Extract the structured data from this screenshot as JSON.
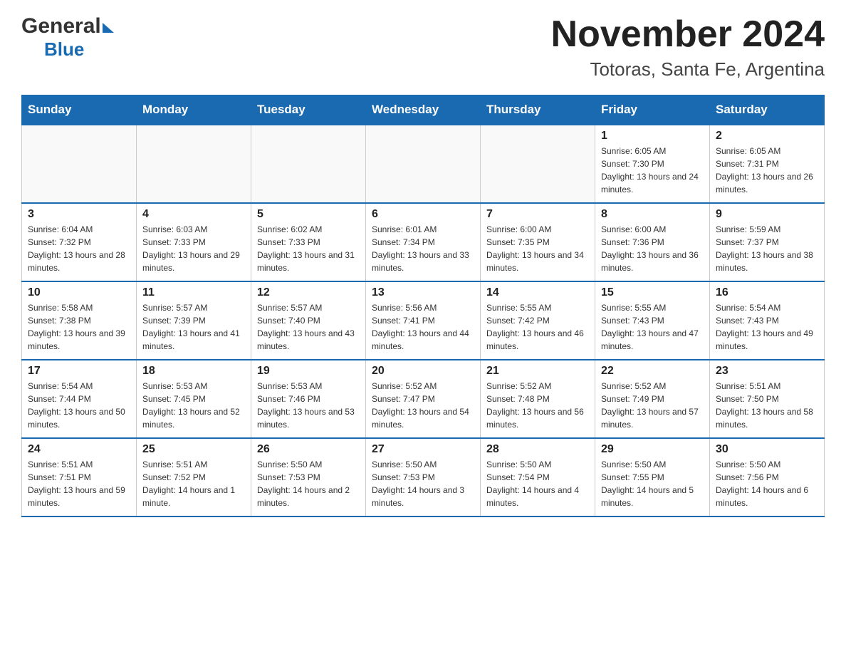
{
  "header": {
    "logo": {
      "general": "General",
      "blue": "Blue"
    },
    "title": "November 2024",
    "location": "Totoras, Santa Fe, Argentina"
  },
  "calendar": {
    "weekdays": [
      "Sunday",
      "Monday",
      "Tuesday",
      "Wednesday",
      "Thursday",
      "Friday",
      "Saturday"
    ],
    "weeks": [
      [
        {
          "day": "",
          "info": ""
        },
        {
          "day": "",
          "info": ""
        },
        {
          "day": "",
          "info": ""
        },
        {
          "day": "",
          "info": ""
        },
        {
          "day": "",
          "info": ""
        },
        {
          "day": "1",
          "info": "Sunrise: 6:05 AM\nSunset: 7:30 PM\nDaylight: 13 hours and 24 minutes."
        },
        {
          "day": "2",
          "info": "Sunrise: 6:05 AM\nSunset: 7:31 PM\nDaylight: 13 hours and 26 minutes."
        }
      ],
      [
        {
          "day": "3",
          "info": "Sunrise: 6:04 AM\nSunset: 7:32 PM\nDaylight: 13 hours and 28 minutes."
        },
        {
          "day": "4",
          "info": "Sunrise: 6:03 AM\nSunset: 7:33 PM\nDaylight: 13 hours and 29 minutes."
        },
        {
          "day": "5",
          "info": "Sunrise: 6:02 AM\nSunset: 7:33 PM\nDaylight: 13 hours and 31 minutes."
        },
        {
          "day": "6",
          "info": "Sunrise: 6:01 AM\nSunset: 7:34 PM\nDaylight: 13 hours and 33 minutes."
        },
        {
          "day": "7",
          "info": "Sunrise: 6:00 AM\nSunset: 7:35 PM\nDaylight: 13 hours and 34 minutes."
        },
        {
          "day": "8",
          "info": "Sunrise: 6:00 AM\nSunset: 7:36 PM\nDaylight: 13 hours and 36 minutes."
        },
        {
          "day": "9",
          "info": "Sunrise: 5:59 AM\nSunset: 7:37 PM\nDaylight: 13 hours and 38 minutes."
        }
      ],
      [
        {
          "day": "10",
          "info": "Sunrise: 5:58 AM\nSunset: 7:38 PM\nDaylight: 13 hours and 39 minutes."
        },
        {
          "day": "11",
          "info": "Sunrise: 5:57 AM\nSunset: 7:39 PM\nDaylight: 13 hours and 41 minutes."
        },
        {
          "day": "12",
          "info": "Sunrise: 5:57 AM\nSunset: 7:40 PM\nDaylight: 13 hours and 43 minutes."
        },
        {
          "day": "13",
          "info": "Sunrise: 5:56 AM\nSunset: 7:41 PM\nDaylight: 13 hours and 44 minutes."
        },
        {
          "day": "14",
          "info": "Sunrise: 5:55 AM\nSunset: 7:42 PM\nDaylight: 13 hours and 46 minutes."
        },
        {
          "day": "15",
          "info": "Sunrise: 5:55 AM\nSunset: 7:43 PM\nDaylight: 13 hours and 47 minutes."
        },
        {
          "day": "16",
          "info": "Sunrise: 5:54 AM\nSunset: 7:43 PM\nDaylight: 13 hours and 49 minutes."
        }
      ],
      [
        {
          "day": "17",
          "info": "Sunrise: 5:54 AM\nSunset: 7:44 PM\nDaylight: 13 hours and 50 minutes."
        },
        {
          "day": "18",
          "info": "Sunrise: 5:53 AM\nSunset: 7:45 PM\nDaylight: 13 hours and 52 minutes."
        },
        {
          "day": "19",
          "info": "Sunrise: 5:53 AM\nSunset: 7:46 PM\nDaylight: 13 hours and 53 minutes."
        },
        {
          "day": "20",
          "info": "Sunrise: 5:52 AM\nSunset: 7:47 PM\nDaylight: 13 hours and 54 minutes."
        },
        {
          "day": "21",
          "info": "Sunrise: 5:52 AM\nSunset: 7:48 PM\nDaylight: 13 hours and 56 minutes."
        },
        {
          "day": "22",
          "info": "Sunrise: 5:52 AM\nSunset: 7:49 PM\nDaylight: 13 hours and 57 minutes."
        },
        {
          "day": "23",
          "info": "Sunrise: 5:51 AM\nSunset: 7:50 PM\nDaylight: 13 hours and 58 minutes."
        }
      ],
      [
        {
          "day": "24",
          "info": "Sunrise: 5:51 AM\nSunset: 7:51 PM\nDaylight: 13 hours and 59 minutes."
        },
        {
          "day": "25",
          "info": "Sunrise: 5:51 AM\nSunset: 7:52 PM\nDaylight: 14 hours and 1 minute."
        },
        {
          "day": "26",
          "info": "Sunrise: 5:50 AM\nSunset: 7:53 PM\nDaylight: 14 hours and 2 minutes."
        },
        {
          "day": "27",
          "info": "Sunrise: 5:50 AM\nSunset: 7:53 PM\nDaylight: 14 hours and 3 minutes."
        },
        {
          "day": "28",
          "info": "Sunrise: 5:50 AM\nSunset: 7:54 PM\nDaylight: 14 hours and 4 minutes."
        },
        {
          "day": "29",
          "info": "Sunrise: 5:50 AM\nSunset: 7:55 PM\nDaylight: 14 hours and 5 minutes."
        },
        {
          "day": "30",
          "info": "Sunrise: 5:50 AM\nSunset: 7:56 PM\nDaylight: 14 hours and 6 minutes."
        }
      ]
    ]
  }
}
